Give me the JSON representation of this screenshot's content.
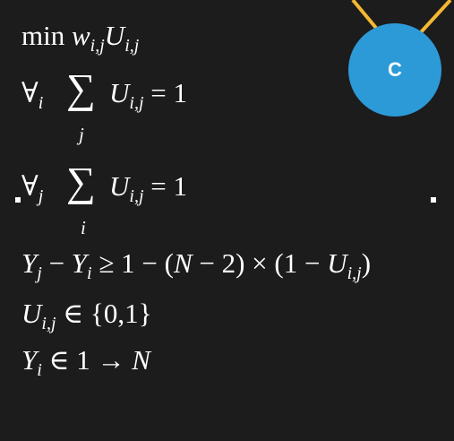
{
  "node": {
    "label": "C",
    "fill": "#2d9ad8",
    "edge_color": "#f4b731"
  },
  "formula": {
    "line1": {
      "prefix": "min ",
      "w": "w",
      "sub1": "i,j",
      "u": "U",
      "sub2": "i,j"
    },
    "line2": {
      "forall": "∀",
      "forall_sub": "i",
      "sum": "∑",
      "sum_idx": "j",
      "u": "U",
      "u_sub": "i,j",
      "rhs": " = 1"
    },
    "line3": {
      "forall": "∀",
      "forall_sub": "j",
      "sum": "∑",
      "sum_idx": "i",
      "u": "U",
      "u_sub": "i,j",
      "rhs": " = 1"
    },
    "line4": {
      "y1": "Y",
      "y1_sub": "j",
      "minus": " − ",
      "y2": "Y",
      "y2_sub": "i",
      "rest1": " ≥ 1 − (",
      "n": "N",
      "rest2": " − 2) × (1 − ",
      "u": "U",
      "u_sub": "i,j",
      "close": ")"
    },
    "line5": {
      "u": "U",
      "u_sub": "i,j",
      "rest": " ∈ {0,1}"
    },
    "line6": {
      "y": "Y",
      "y_sub": "i",
      "rest": " ∈ 1 → ",
      "n": "N"
    }
  }
}
